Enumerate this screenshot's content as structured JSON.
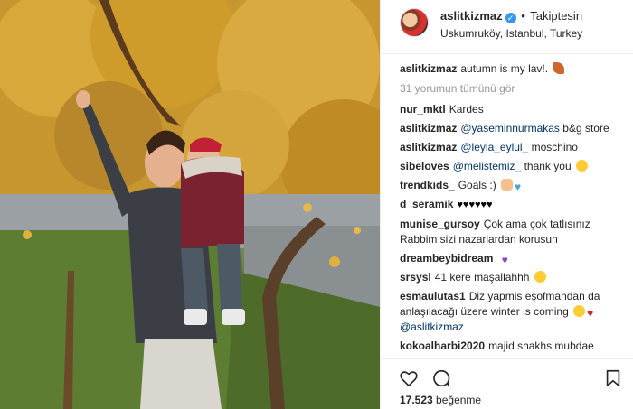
{
  "header": {
    "username": "aslitkizmaz",
    "dot": "•",
    "follow_state": "Takiptesin",
    "location": "Uskumruköy, Istanbul, Turkey"
  },
  "caption": {
    "username": "aslitkizmaz",
    "text": "autumn is my lav!."
  },
  "view_all_comments": "31 yorumun tümünü gör",
  "comments": [
    {
      "username": "nur_mktl",
      "text": "Kardes"
    },
    {
      "username": "aslitkizmaz",
      "mention": "@yaseminnurmakas",
      "text": "b&g store"
    },
    {
      "username": "aslitkizmaz",
      "mention": "@leyla_eylul_",
      "text": "moschino"
    },
    {
      "username": "sibeloves",
      "mention": "@melistemiz_",
      "text": "thank you"
    },
    {
      "username": "trendkids_",
      "text": "Goals :)"
    },
    {
      "username": "d_seramik",
      "text": "♥♥♥♥♥♥"
    },
    {
      "username": "munise_gursoy",
      "text": "Çok ama çok tatlısınız Rabbim sizi nazarlardan korusun"
    },
    {
      "username": "dreambeybidream",
      "text": ""
    },
    {
      "username": "srsysl",
      "text": "41 kere maşallahhh"
    },
    {
      "username": "esmaulutas1",
      "text": "Diz yapmis eşofmandan da anlaşılacağı üzere winter is coming",
      "mention_after": "@aslitkizmaz"
    },
    {
      "username": "kokoalharbi2020",
      "text": "majid shakhs mubdae"
    }
  ],
  "icons": {
    "verified": "verified-badge-icon",
    "like": "heart-outline-icon",
    "comment": "comment-bubble-icon",
    "save": "bookmark-icon"
  },
  "likes": {
    "count": "17.523",
    "label": "beğenme"
  },
  "colors": {
    "mention": "#003569",
    "muted": "#999999",
    "verified": "#3897f0",
    "border": "#efefef"
  }
}
